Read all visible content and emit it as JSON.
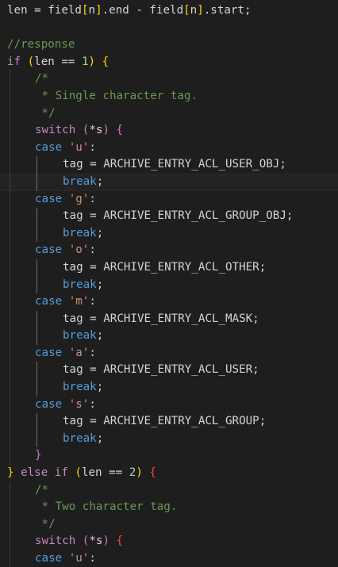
{
  "editor": {
    "colors": {
      "background": "#1e1e1e",
      "default": "#d4d4d4",
      "keyword": "#c586c0",
      "storage": "#569cd6",
      "number": "#b5cea8",
      "string": "#ce9178",
      "comment": "#6a9955",
      "bracket_level_1": "#ffd700",
      "bracket_level_2": "#da70d6",
      "bracket_level_3": "#179fff",
      "unmatched_bracket": "#f44747"
    },
    "current_line": 10,
    "lines": [
      {
        "indent": 0,
        "tokens": [
          {
            "t": "len = field",
            "k": "default"
          },
          {
            "t": "[",
            "k": "b1"
          },
          {
            "t": "n",
            "k": "default"
          },
          {
            "t": "]",
            "k": "b1"
          },
          {
            "t": ".end - field",
            "k": "default"
          },
          {
            "t": "[",
            "k": "b1"
          },
          {
            "t": "n",
            "k": "default"
          },
          {
            "t": "]",
            "k": "b1"
          },
          {
            "t": ".start;",
            "k": "default"
          }
        ]
      },
      {
        "indent": 0,
        "tokens": []
      },
      {
        "indent": 0,
        "tokens": [
          {
            "t": "//response",
            "k": "comment"
          }
        ]
      },
      {
        "indent": 0,
        "tokens": [
          {
            "t": "if ",
            "k": "keyword"
          },
          {
            "t": "(",
            "k": "b1"
          },
          {
            "t": "len == ",
            "k": "default"
          },
          {
            "t": "1",
            "k": "number"
          },
          {
            "t": ")",
            "k": "b1"
          },
          {
            "t": " ",
            "k": "default"
          },
          {
            "t": "{",
            "k": "b1"
          }
        ]
      },
      {
        "indent": 1,
        "tokens": [
          {
            "t": "/*",
            "k": "comment"
          }
        ]
      },
      {
        "indent": 1,
        "tokens": [
          {
            "t": " * Single character tag.",
            "k": "comment"
          }
        ]
      },
      {
        "indent": 1,
        "tokens": [
          {
            "t": " */",
            "k": "comment"
          }
        ]
      },
      {
        "indent": 1,
        "tokens": [
          {
            "t": "switch ",
            "k": "keyword"
          },
          {
            "t": "(",
            "k": "b2"
          },
          {
            "t": "*s",
            "k": "default"
          },
          {
            "t": ")",
            "k": "b2"
          },
          {
            "t": " ",
            "k": "default"
          },
          {
            "t": "{",
            "k": "b2"
          }
        ]
      },
      {
        "indent": 1,
        "tokens": [
          {
            "t": "case ",
            "k": "storage"
          },
          {
            "t": "'u'",
            "k": "string"
          },
          {
            "t": ":",
            "k": "default"
          }
        ]
      },
      {
        "indent": 2,
        "tokens": [
          {
            "t": "tag = ARCHIVE_ENTRY_ACL_USER_OBJ;",
            "k": "default"
          }
        ]
      },
      {
        "indent": 2,
        "tokens": [
          {
            "t": "break",
            "k": "storage"
          },
          {
            "t": ";",
            "k": "default"
          }
        ]
      },
      {
        "indent": 1,
        "tokens": [
          {
            "t": "case ",
            "k": "storage"
          },
          {
            "t": "'g'",
            "k": "string"
          },
          {
            "t": ":",
            "k": "default"
          }
        ]
      },
      {
        "indent": 2,
        "tokens": [
          {
            "t": "tag = ARCHIVE_ENTRY_ACL_GROUP_OBJ;",
            "k": "default"
          }
        ]
      },
      {
        "indent": 2,
        "tokens": [
          {
            "t": "break",
            "k": "storage"
          },
          {
            "t": ";",
            "k": "default"
          }
        ]
      },
      {
        "indent": 1,
        "tokens": [
          {
            "t": "case ",
            "k": "storage"
          },
          {
            "t": "'o'",
            "k": "string"
          },
          {
            "t": ":",
            "k": "default"
          }
        ]
      },
      {
        "indent": 2,
        "tokens": [
          {
            "t": "tag = ARCHIVE_ENTRY_ACL_OTHER;",
            "k": "default"
          }
        ]
      },
      {
        "indent": 2,
        "tokens": [
          {
            "t": "break",
            "k": "storage"
          },
          {
            "t": ";",
            "k": "default"
          }
        ]
      },
      {
        "indent": 1,
        "tokens": [
          {
            "t": "case ",
            "k": "storage"
          },
          {
            "t": "'m'",
            "k": "string"
          },
          {
            "t": ":",
            "k": "default"
          }
        ]
      },
      {
        "indent": 2,
        "tokens": [
          {
            "t": "tag = ARCHIVE_ENTRY_ACL_MASK;",
            "k": "default"
          }
        ]
      },
      {
        "indent": 2,
        "tokens": [
          {
            "t": "break",
            "k": "storage"
          },
          {
            "t": ";",
            "k": "default"
          }
        ]
      },
      {
        "indent": 1,
        "tokens": [
          {
            "t": "case ",
            "k": "storage"
          },
          {
            "t": "'a'",
            "k": "string"
          },
          {
            "t": ":",
            "k": "default"
          }
        ]
      },
      {
        "indent": 2,
        "tokens": [
          {
            "t": "tag = ARCHIVE_ENTRY_ACL_USER;",
            "k": "default"
          }
        ]
      },
      {
        "indent": 2,
        "tokens": [
          {
            "t": "break",
            "k": "storage"
          },
          {
            "t": ";",
            "k": "default"
          }
        ]
      },
      {
        "indent": 1,
        "tokens": [
          {
            "t": "case ",
            "k": "storage"
          },
          {
            "t": "'s'",
            "k": "string"
          },
          {
            "t": ":",
            "k": "default"
          }
        ]
      },
      {
        "indent": 2,
        "tokens": [
          {
            "t": "tag = ARCHIVE_ENTRY_ACL_GROUP;",
            "k": "default"
          }
        ]
      },
      {
        "indent": 2,
        "tokens": [
          {
            "t": "break",
            "k": "storage"
          },
          {
            "t": ";",
            "k": "default"
          }
        ]
      },
      {
        "indent": 1,
        "tokens": [
          {
            "t": "}",
            "k": "b2"
          }
        ]
      },
      {
        "indent": 0,
        "tokens": [
          {
            "t": "}",
            "k": "b1"
          },
          {
            "t": " else if ",
            "k": "keyword"
          },
          {
            "t": "(",
            "k": "b1"
          },
          {
            "t": "len == ",
            "k": "default"
          },
          {
            "t": "2",
            "k": "number"
          },
          {
            "t": ")",
            "k": "b1"
          },
          {
            "t": " ",
            "k": "default"
          },
          {
            "t": "{",
            "k": "err"
          }
        ]
      },
      {
        "indent": 1,
        "tokens": [
          {
            "t": "/*",
            "k": "comment"
          }
        ]
      },
      {
        "indent": 1,
        "tokens": [
          {
            "t": " * Two character tag.",
            "k": "comment"
          }
        ]
      },
      {
        "indent": 1,
        "tokens": [
          {
            "t": " */",
            "k": "comment"
          }
        ]
      },
      {
        "indent": 1,
        "tokens": [
          {
            "t": "switch ",
            "k": "keyword"
          },
          {
            "t": "(",
            "k": "b2"
          },
          {
            "t": "*s",
            "k": "default"
          },
          {
            "t": ")",
            "k": "b2"
          },
          {
            "t": " ",
            "k": "default"
          },
          {
            "t": "{",
            "k": "err"
          }
        ]
      },
      {
        "indent": 1,
        "tokens": [
          {
            "t": "case ",
            "k": "storage"
          },
          {
            "t": "'u'",
            "k": "string"
          },
          {
            "t": ":",
            "k": "default"
          }
        ]
      }
    ]
  }
}
